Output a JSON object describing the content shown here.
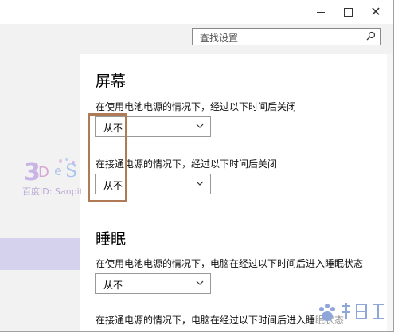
{
  "window_controls": {
    "minimize": "—",
    "maximize": "□",
    "close": "✕"
  },
  "search": {
    "placeholder": "查找设置",
    "icon": "search-icon"
  },
  "screen_section": {
    "title": "屏幕",
    "battery_label": "在使用电池电源的情况下，经过以下时间后关闭",
    "battery_value": "从不",
    "plugged_label": "在接通电源的情况下，经过以下时间后关闭",
    "plugged_value": "从不"
  },
  "sleep_section": {
    "title": "睡眠",
    "battery_label": "在使用电池电源的情况下，电脑在经过以下时间后进入睡眠状态",
    "battery_value": "从不",
    "plugged_label": "在接通电源的情况下，电脑在经过以下时间后进入睡眠状态"
  },
  "watermark": {
    "text": "百度ID: Sanpitt"
  },
  "colors": {
    "sidebar_bg": "#f2f2f2",
    "sidebar_selected": "#d4d2ec",
    "highlight_border": "#b07a56",
    "accent": "#b07a56"
  }
}
